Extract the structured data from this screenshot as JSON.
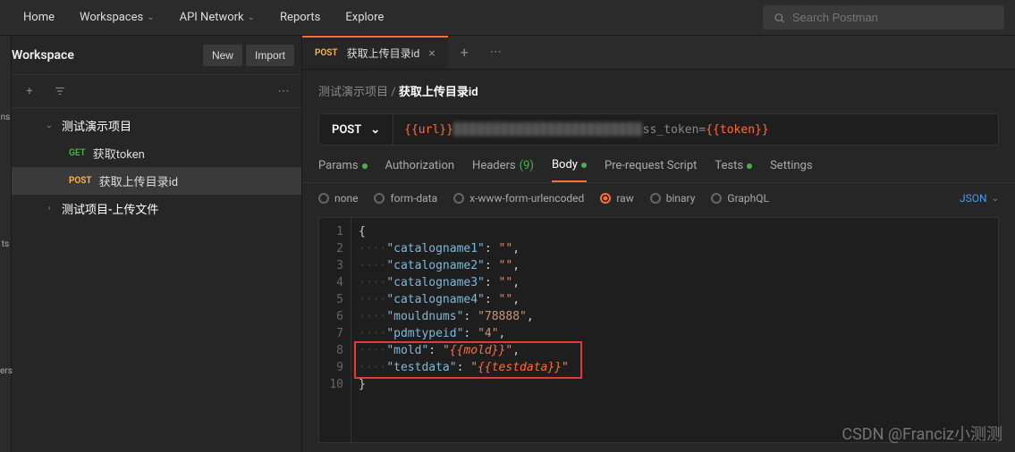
{
  "topnav": {
    "items": [
      "Home",
      "Workspaces",
      "API Network",
      "Reports",
      "Explore"
    ],
    "dropdown": [
      false,
      true,
      true,
      false,
      false
    ],
    "search_placeholder": "Search Postman"
  },
  "workspace": {
    "title": "Workspace",
    "new_btn": "New",
    "import_btn": "Import"
  },
  "left_rail": [
    "ns",
    "ts",
    "ers"
  ],
  "tree": {
    "collection1": {
      "name": "测试演示项目",
      "expanded": true
    },
    "item1": {
      "method": "GET",
      "label": "获取token"
    },
    "item2": {
      "method": "POST",
      "label": "获取上传目录id"
    },
    "collection2": {
      "name": "测试项目-上传文件",
      "expanded": false
    }
  },
  "tab": {
    "method": "POST",
    "label": "获取上传目录id"
  },
  "breadcrumb": {
    "parent": "测试演示项目",
    "sep": " / ",
    "current": "获取上传目录id"
  },
  "request": {
    "method": "POST",
    "url_prefix": "{{url}}",
    "url_blur": "████████████████████████",
    "url_suffix_key": "ss_token=",
    "url_suffix_val": "{{token}}"
  },
  "req_tabs": {
    "params": "Params",
    "auth": "Authorization",
    "headers_label": "Headers",
    "headers_count": "(9)",
    "body": "Body",
    "prerequest": "Pre-request Script",
    "tests": "Tests",
    "settings": "Settings"
  },
  "body_types": {
    "none": "none",
    "formdata": "form-data",
    "urlencoded": "x-www-form-urlencoded",
    "raw": "raw",
    "binary": "binary",
    "graphql": "GraphQL",
    "json": "JSON"
  },
  "code": {
    "line1": "{",
    "dots": "····",
    "k1": "\"catalogname1\"",
    "v1": "\"\"",
    "k2": "\"catalogname2\"",
    "v2": "\"\"",
    "k3": "\"catalogname3\"",
    "v3": "\"\"",
    "k4": "\"catalogname4\"",
    "v4": "\"\"",
    "k5": "\"mouldnums\"",
    "v5": "\"78888\"",
    "k6": "\"pdmtypeid\"",
    "v6": "\"4\"",
    "k7": "\"mold\"",
    "v7a": "\"",
    "v7b": "{{mold}}",
    "v7c": "\"",
    "k8": "\"testdata\"",
    "v8a": "\"",
    "v8b": "{{testdata}}",
    "v8c": "\"",
    "line10": "}"
  },
  "line_numbers": [
    "1",
    "2",
    "3",
    "4",
    "5",
    "6",
    "7",
    "8",
    "9",
    "10"
  ],
  "watermark": "CSDN @Franciz小测测"
}
